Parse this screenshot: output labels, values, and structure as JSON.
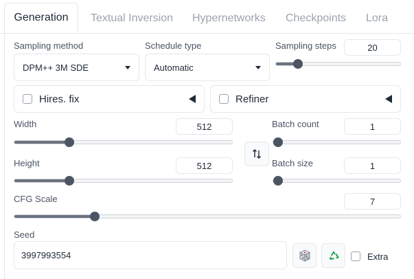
{
  "tabs": [
    "Generation",
    "Textual Inversion",
    "Hypernetworks",
    "Checkpoints",
    "Lora"
  ],
  "sampling_method": {
    "label": "Sampling method",
    "value": "DPM++ 3M SDE"
  },
  "schedule_type": {
    "label": "Schedule type",
    "value": "Automatic"
  },
  "sampling_steps": {
    "label": "Sampling steps",
    "value": "20",
    "level": 0.15
  },
  "hires_fix": {
    "label": "Hires. fix",
    "checked": false
  },
  "refiner": {
    "label": "Refiner",
    "checked": false
  },
  "width": {
    "label": "Width",
    "value": "512",
    "level": 0.24
  },
  "height": {
    "label": "Height",
    "value": "512",
    "level": 0.24
  },
  "batch_count": {
    "label": "Batch count",
    "value": "1",
    "level": 0.0
  },
  "batch_size": {
    "label": "Batch size",
    "value": "1",
    "level": 0.0
  },
  "cfg_scale": {
    "label": "CFG Scale",
    "value": "7",
    "level": 0.2
  },
  "seed": {
    "label": "Seed",
    "value": "3997993554",
    "extra_label": "Extra"
  },
  "icons": {
    "swap": "swap-dimensions-icon",
    "dice": "dice-icon",
    "recycle": "recycle-icon"
  },
  "colors": {
    "accent": "#4b5563",
    "recycle": "#16a34a",
    "border": "#e5e7eb"
  }
}
